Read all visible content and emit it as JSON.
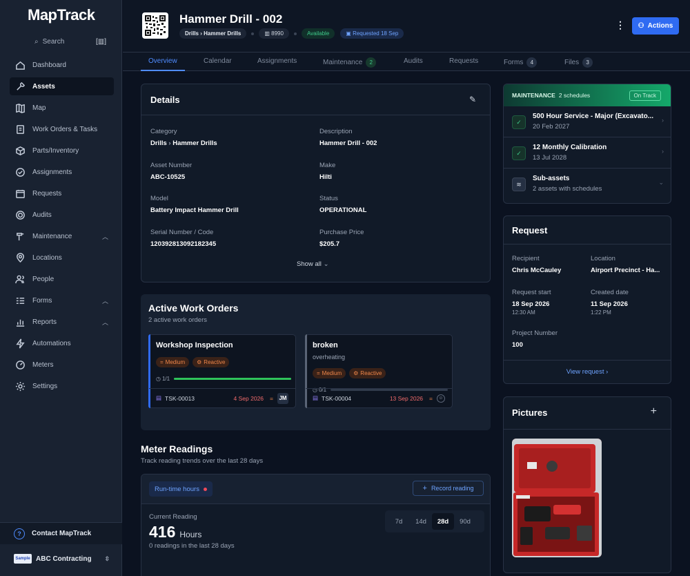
{
  "app": {
    "name": "MapTrack"
  },
  "sidebar": {
    "search_label": "Search",
    "items": [
      {
        "label": "Dashboard",
        "icon": "dashboard-icon"
      },
      {
        "label": "Assets",
        "icon": "wrench-icon"
      },
      {
        "label": "Map",
        "icon": "map-icon"
      },
      {
        "label": "Work Orders & Tasks",
        "icon": "clipboard-icon"
      },
      {
        "label": "Parts/Inventory",
        "icon": "box-icon"
      },
      {
        "label": "Assignments",
        "icon": "check-circle-icon"
      },
      {
        "label": "Requests",
        "icon": "calendar-icon"
      },
      {
        "label": "Audits",
        "icon": "target-icon"
      },
      {
        "label": "Maintenance",
        "icon": "tools-icon"
      },
      {
        "label": "Locations",
        "icon": "pin-icon"
      },
      {
        "label": "People",
        "icon": "people-icon"
      },
      {
        "label": "Forms",
        "icon": "list-icon"
      },
      {
        "label": "Reports",
        "icon": "chart-icon"
      },
      {
        "label": "Automations",
        "icon": "bolt-icon"
      },
      {
        "label": "Meters",
        "icon": "gauge-icon"
      },
      {
        "label": "Settings",
        "icon": "gear-icon"
      }
    ],
    "contact_label": "Contact MapTrack",
    "org_name": "ABC Contracting",
    "org_logo_text": "Sample"
  },
  "header": {
    "title": "Hammer Drill - 002",
    "breadcrumb_parent": "Drills",
    "breadcrumb_child": "Hammer Drills",
    "code": "8990",
    "status": "Available",
    "requested": "Requested 18 Sep",
    "actions_label": "Actions"
  },
  "tabs": [
    {
      "label": "Overview"
    },
    {
      "label": "Calendar"
    },
    {
      "label": "Assignments"
    },
    {
      "label": "Maintenance",
      "badge": "2"
    },
    {
      "label": "Audits"
    },
    {
      "label": "Requests"
    },
    {
      "label": "Forms",
      "badge": "4"
    },
    {
      "label": "Files",
      "badge": "3"
    }
  ],
  "details": {
    "title": "Details",
    "fields": [
      {
        "label": "Category",
        "value_parent": "Drills",
        "value_child": "Hammer Drills"
      },
      {
        "label": "Description",
        "value": "Hammer Drill - 002"
      },
      {
        "label": "Asset Number",
        "value": "ABC-10525"
      },
      {
        "label": "Make",
        "value": "Hilti"
      },
      {
        "label": "Model",
        "value": "Battery Impact Hammer Drill"
      },
      {
        "label": "Status",
        "value": "OPERATIONAL"
      },
      {
        "label": "Serial Number / Code",
        "value": "120392813092182345"
      },
      {
        "label": "Purchase Price",
        "value": "$205.7"
      }
    ],
    "show_all": "Show all"
  },
  "work_orders": {
    "title": "Active Work Orders",
    "subtitle": "2 active work orders",
    "items": [
      {
        "title": "Workshop Inspection",
        "description": "",
        "priority": "Medium",
        "type": "Reactive",
        "progress_text": "1/1",
        "progress": 1.0,
        "id": "TSK-00013",
        "date": "4 Sep 2026",
        "assignee": "JM",
        "bar_color": "#2f6bf2"
      },
      {
        "title": "broken",
        "description": "overheating",
        "priority": "Medium",
        "type": "Reactive",
        "progress_text": "0/1",
        "progress": 0.0,
        "id": "TSK-00004",
        "date": "13 Sep 2026",
        "assignee": "",
        "bar_color": "#5a6476"
      }
    ]
  },
  "meters": {
    "title": "Meter Readings",
    "subtitle": "Track reading trends over the last 28 days",
    "tab": "Run-time hours",
    "record_label": "Record reading",
    "current_label": "Current Reading",
    "current_value": "416",
    "current_unit": "Hours",
    "readings_note": "0 readings in the last 28 days",
    "ranges": [
      "7d",
      "14d",
      "28d",
      "90d"
    ],
    "selected_range": "28d"
  },
  "maintenance": {
    "label": "MAINTENANCE",
    "count": "2 schedules",
    "status": "On Track",
    "schedules": [
      {
        "title": "500 Hour Service - Major (Excavato...",
        "date": "20 Feb 2027"
      },
      {
        "title": "12 Monthly Calibration",
        "date": "13 Jul 2028"
      }
    ],
    "sub_assets_title": "Sub-assets",
    "sub_assets_note": "2 assets with schedules"
  },
  "request": {
    "title": "Request",
    "recipient_label": "Recipient",
    "recipient": "Chris McCauley",
    "location_label": "Location",
    "location": "Airport Precinct - Ha...",
    "start_label": "Request start",
    "start_date": "18 Sep 2026",
    "start_time": "12:30 AM",
    "created_label": "Created date",
    "created_date": "11 Sep 2026",
    "created_time": "1:22 PM",
    "project_label": "Project Number",
    "project": "100",
    "view_label": "View request"
  },
  "pictures": {
    "title": "Pictures"
  }
}
